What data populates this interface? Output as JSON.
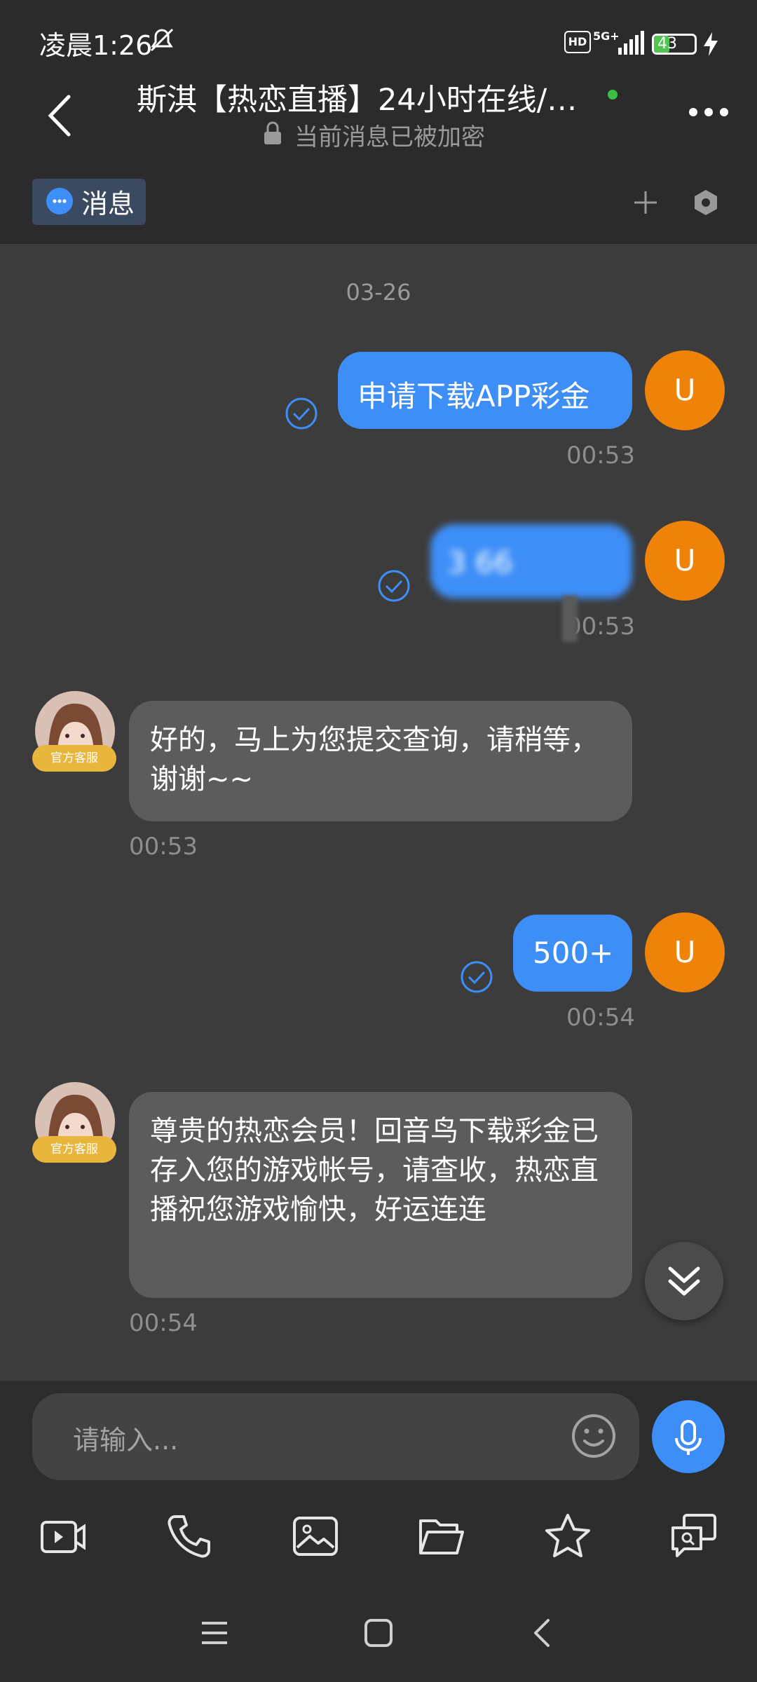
{
  "status_bar": {
    "time": "凌晨1:26",
    "hd_label": "HD",
    "network": "5G+",
    "battery": "43"
  },
  "header": {
    "title": "斯淇【热恋直播】24小时在线/…",
    "subtitle": "当前消息已被加密"
  },
  "tabs": {
    "active_label": "消息"
  },
  "chat": {
    "date": "03-26",
    "user_avatar_letter": "U",
    "agent_badge": "官方客服",
    "messages": [
      {
        "text": "申请下载APP彩金",
        "time": "00:53"
      },
      {
        "text": "3        66",
        "time": "00:53"
      },
      {
        "text": "好的，马上为您提交查询，请稍等，谢谢~~",
        "time": "00:53"
      },
      {
        "text": "500+",
        "time": "00:54"
      },
      {
        "text": "尊贵的热恋会员！回音鸟下载彩金已存入您的游戏帐号，请查收，热恋直播祝您游戏愉快，好运连连",
        "time": "00:54"
      }
    ]
  },
  "input": {
    "placeholder": "请输入..."
  },
  "colors": {
    "accent": "#3d8ef7",
    "user_avatar": "#ef8209",
    "agent_badge": "#e8b53d",
    "incoming_bubble": "#5c5c5c",
    "background": "#3c3c3c"
  },
  "icons": {
    "toolbar": [
      "video-message-icon",
      "phone-icon",
      "image-icon",
      "folder-icon",
      "star-icon",
      "quick-reply-icon"
    ],
    "nav": [
      "menu-icon",
      "home-icon",
      "back-icon"
    ]
  }
}
